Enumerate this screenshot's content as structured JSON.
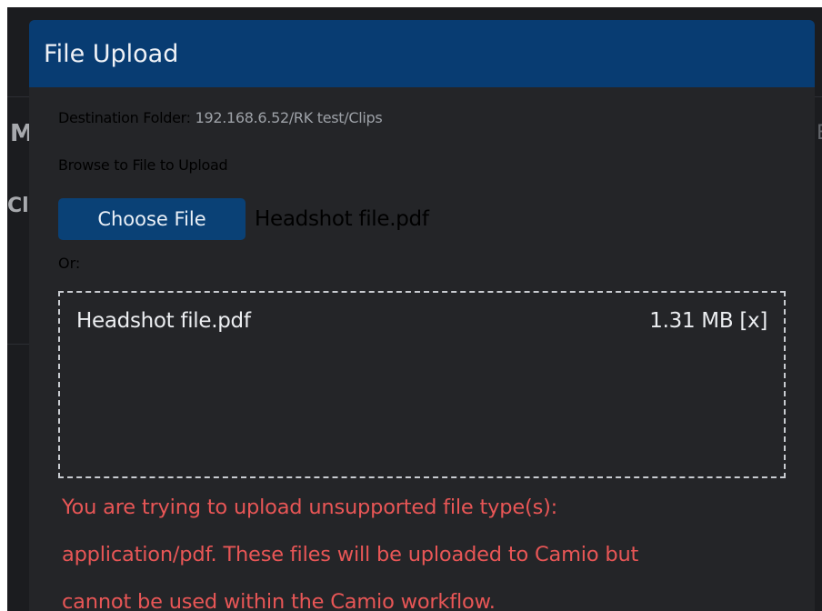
{
  "background": {
    "fragments": [
      "M",
      "Cl",
      "E"
    ]
  },
  "dialog": {
    "title": "File Upload",
    "destination_label": "Destination Folder:",
    "destination_path": "192.168.6.52/RK test/Clips",
    "browse_label": "Browse to File to Upload",
    "choose_button_label": "Choose File",
    "chosen_file_name": "Headshot file.pdf",
    "or_label": "Or:",
    "queued_files": [
      {
        "name": "Headshot file.pdf",
        "size": "1.31 MB",
        "remove_label": "[x]"
      }
    ],
    "error_lines": [
      "You are trying to upload unsupported file type(s):",
      "application/pdf. These files will be uploaded to Camio but",
      "cannot be used within the Camio workflow."
    ]
  },
  "colors": {
    "header": "#083c72",
    "button": "#0a4176",
    "dialog_bg": "#242528",
    "error": "#e85656",
    "path_text": "#9da1a7"
  }
}
